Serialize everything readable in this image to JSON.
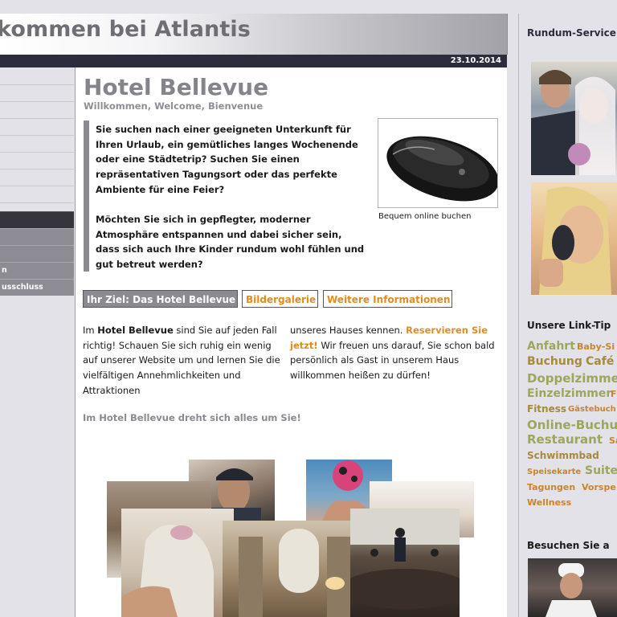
{
  "header": {
    "title": "kommen bei Atlantis",
    "date": "23.10.2014"
  },
  "leftnav": {
    "items": [
      "",
      "",
      "",
      "",
      "",
      "",
      "",
      "",
      "",
      "",
      "n",
      "usschluss"
    ]
  },
  "main": {
    "title": "Hotel Bellevue",
    "subtitle": "Willkommen, Welcome, Bienvenue",
    "quote1": "Sie suchen nach einer geeigneten Unterkunft für Ihren Urlaub, ein gemütliches langes Wochenende oder eine Städtetrip? Suchen Sie einen repräsentativen Tagungsort oder das perfekte Ambiente für eine Feier?",
    "quote2": "Möchten Sie sich in gepflegter, moderner Atmosphäre entspannen und dabei sicher sein, dass sich auch Ihre Kinder rundum wohl fühlen und gut betreut werden?",
    "image_caption": "Bequem online buchen",
    "tabs": [
      "Ihr Ziel: Das Hotel Bellevue",
      "Bildergalerie",
      "Weitere Informationen"
    ],
    "para_left_pre": "Im ",
    "para_left_bold": "Hotel Bellevue",
    "para_left_post": " sind Sie auf jeden Fall richtig! Schauen Sie sich ruhig ein wenig auf unserer Website um und lernen Sie die vielfältigen Annehmlichkeiten und Attraktionen",
    "para_right_pre": "unseres Hauses kennen. ",
    "para_right_link": "Reservieren Sie jetzt!",
    "para_right_post": " Wir freuen uns darauf, Sie schon bald persönlich als Gast in unserem Haus willkommen heißen zu dürfen!",
    "tagline": "Im Hotel Bellevue dreht sich alles um Sie!"
  },
  "sidebar": {
    "service_title": "Rundum-Service Sie!",
    "linktips_title": "Unsere Link-Tip",
    "tags": [
      "Anfahrt",
      "Baby-Si",
      "Buchung",
      "Café",
      "Doppelzimmer",
      "Einzelzimmer",
      "F",
      "Fitness",
      "Gästebuch",
      "Online-Buchun",
      "Restaurant",
      "Sa",
      "Schwimmbad",
      "Speisekarte",
      "Suite",
      "Tagungen",
      "Vorspe",
      "Wellness"
    ],
    "visit_title": "Besuchen Sie a"
  },
  "colors": {
    "accent_orange": "#df8d22",
    "tag_green": "#9ea65b",
    "dark_bar": "#2d2c3c"
  }
}
